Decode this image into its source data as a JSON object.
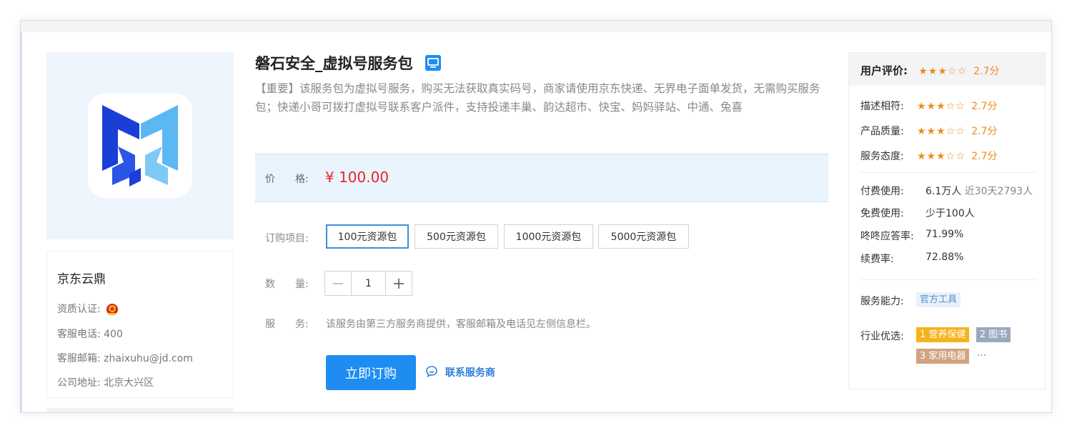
{
  "product": {
    "title": "磐石安全_虚拟号服务包",
    "description": "【重要】该服务包为虚拟号服务，购买无法获取真实码号，商家请使用京东快递、无界电子面单发货，无需购买服务包；快递小哥可拨打虚拟号联系客户派件，支持投递丰巢、韵达超市、快宝、妈妈驿站、中通、兔喜",
    "price_label": "价　　格:",
    "price": "¥ 100.00",
    "options_label": "订购项目:",
    "options": [
      "100元资源包",
      "500元资源包",
      "1000元资源包",
      "5000元资源包"
    ],
    "selected_option": "100元资源包",
    "quantity_label": "数　　量:",
    "quantity": "1",
    "service_label": "服　　务:",
    "service_text": "该服务由第三方服务商提供，客服邮箱及电话见左侧信息栏。",
    "buy_label": "立即订购",
    "contact_label": "联系服务商"
  },
  "company": {
    "name": "京东云鼎",
    "cert_label": "资质认证:",
    "phone_label": "客服电话:",
    "phone": "400",
    "email_label": "客服邮箱:",
    "email": "zhaixuhu@jd.com",
    "address_label": "公司地址:",
    "address": "北京大兴区"
  },
  "ratings": {
    "header_label": "用户评价:",
    "overall": {
      "stars": "★★★☆☆",
      "score": "2.7分",
      "value": 2.7
    },
    "items": [
      {
        "label": "描述相符:",
        "stars": "★★★☆☆",
        "score": "2.7分"
      },
      {
        "label": "产品质量:",
        "stars": "★★★☆☆",
        "score": "2.7分"
      },
      {
        "label": "服务态度:",
        "stars": "★★★☆☆",
        "score": "2.7分"
      }
    ],
    "stats": [
      {
        "label": "付费使用:",
        "value": "6.1万人",
        "extra": "近30天2793人"
      },
      {
        "label": "免费使用:",
        "value": "少于100人",
        "extra": ""
      },
      {
        "label": "咚咚应答率:",
        "value": "71.99%",
        "extra": ""
      },
      {
        "label": "续费率:",
        "value": "72.88%",
        "extra": ""
      }
    ],
    "capability_label": "服务能力:",
    "capability_tag": "官方工具",
    "industry_label": "行业优选:",
    "industry_tags": [
      "1 营养保健",
      "2 图书",
      "3 家用电器"
    ],
    "more": "···"
  },
  "colors": {
    "price_red": "#e4272a",
    "primary_blue": "#1f8cf2",
    "star_orange": "#f08a1c"
  },
  "icons": {
    "monitor": "monitor-icon",
    "chat": "chat-icon",
    "certification": "police-badge-icon"
  }
}
